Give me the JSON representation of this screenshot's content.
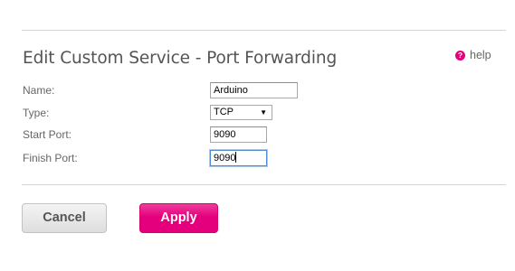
{
  "header": {
    "title": "Edit Custom Service - Port Forwarding",
    "help_label": "help",
    "help_icon": "question-circle-icon"
  },
  "form": {
    "name": {
      "label": "Name:",
      "value": "Arduino"
    },
    "type": {
      "label": "Type:",
      "value": "TCP",
      "options": [
        "TCP"
      ]
    },
    "start_port": {
      "label": "Start Port:",
      "value": "9090"
    },
    "finish_port": {
      "label": "Finish Port:",
      "value": "9090"
    }
  },
  "actions": {
    "cancel_label": "Cancel",
    "apply_label": "Apply"
  },
  "colors": {
    "accent": "#e4007c",
    "text": "#666666",
    "rule": "#d4d4d4"
  }
}
